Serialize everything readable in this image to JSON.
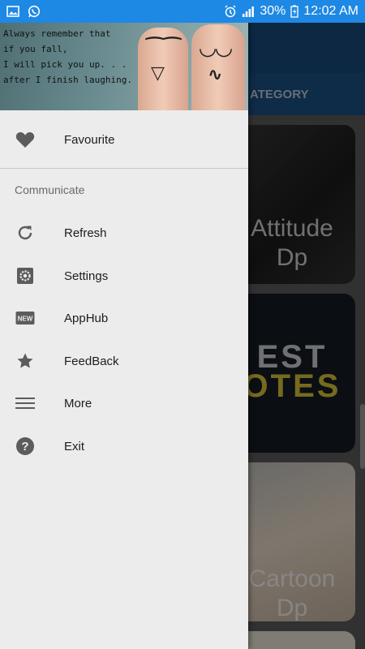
{
  "status_bar": {
    "battery": "30%",
    "time": "12:02 AM",
    "icons": [
      "image-icon",
      "whatsapp-icon",
      "alarm-icon",
      "signal-icon",
      "battery-icon"
    ]
  },
  "app": {
    "tab_label": "ATEGORY",
    "cards": [
      {
        "title": "Attitude Dp"
      },
      {
        "title_line1": "EST",
        "title_line2": "OTES"
      },
      {
        "title": "Cartoon Dp"
      }
    ]
  },
  "drawer": {
    "header": {
      "quote_lines": [
        "Always remember that",
        "if you fall,",
        "I will pick you up. . .",
        "after I finish laughing."
      ]
    },
    "favourite": {
      "label": "Favourite",
      "icon": "heart-icon"
    },
    "section_title": "Communicate",
    "items": [
      {
        "label": "Refresh",
        "icon": "refresh-icon"
      },
      {
        "label": "Settings",
        "icon": "settings-icon"
      },
      {
        "label": "AppHub",
        "icon": "new-badge-icon"
      },
      {
        "label": "FeedBack",
        "icon": "star-icon"
      },
      {
        "label": "More",
        "icon": "menu-lines-icon"
      },
      {
        "label": "Exit",
        "icon": "help-icon"
      }
    ]
  },
  "colors": {
    "status_bar": "#1e88e5",
    "toolbar": "#174a7a",
    "drawer_bg": "#ececec",
    "icon_gray": "#5c5c5c"
  }
}
